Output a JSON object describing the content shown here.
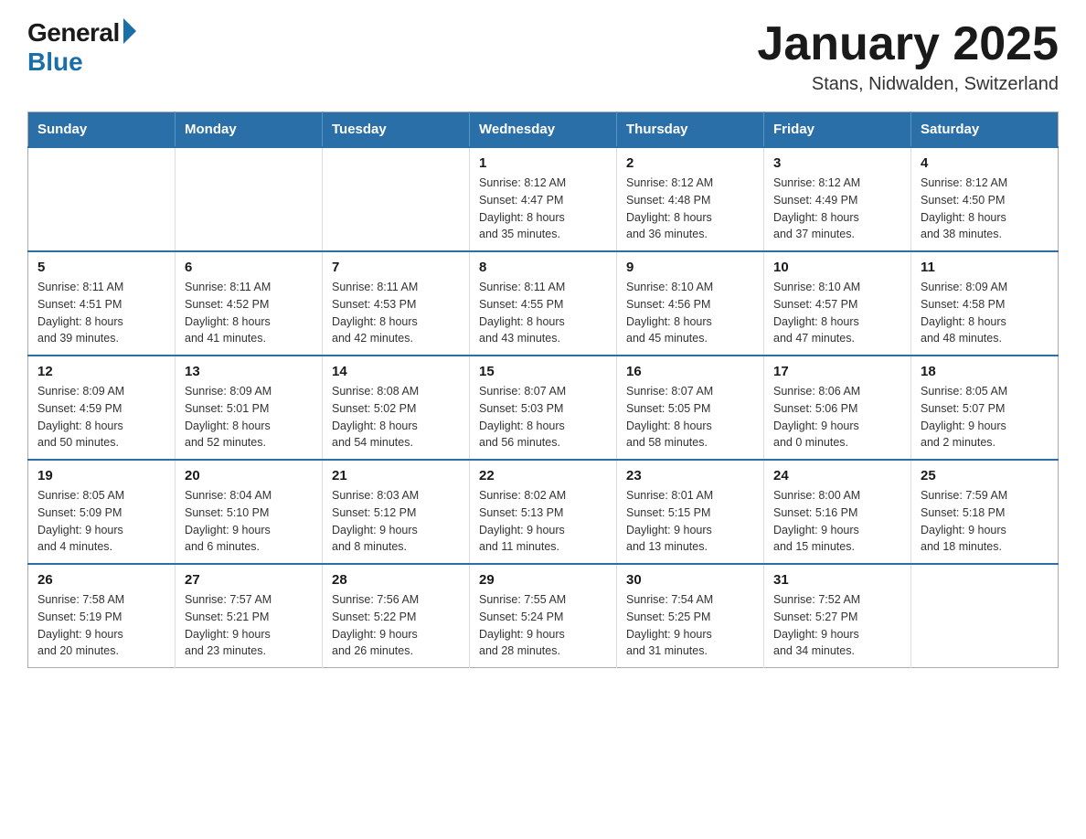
{
  "header": {
    "logo_general": "General",
    "logo_blue": "Blue",
    "month_title": "January 2025",
    "location": "Stans, Nidwalden, Switzerland"
  },
  "days_of_week": [
    "Sunday",
    "Monday",
    "Tuesday",
    "Wednesday",
    "Thursday",
    "Friday",
    "Saturday"
  ],
  "weeks": [
    [
      {
        "day": "",
        "info": ""
      },
      {
        "day": "",
        "info": ""
      },
      {
        "day": "",
        "info": ""
      },
      {
        "day": "1",
        "info": "Sunrise: 8:12 AM\nSunset: 4:47 PM\nDaylight: 8 hours\nand 35 minutes."
      },
      {
        "day": "2",
        "info": "Sunrise: 8:12 AM\nSunset: 4:48 PM\nDaylight: 8 hours\nand 36 minutes."
      },
      {
        "day": "3",
        "info": "Sunrise: 8:12 AM\nSunset: 4:49 PM\nDaylight: 8 hours\nand 37 minutes."
      },
      {
        "day": "4",
        "info": "Sunrise: 8:12 AM\nSunset: 4:50 PM\nDaylight: 8 hours\nand 38 minutes."
      }
    ],
    [
      {
        "day": "5",
        "info": "Sunrise: 8:11 AM\nSunset: 4:51 PM\nDaylight: 8 hours\nand 39 minutes."
      },
      {
        "day": "6",
        "info": "Sunrise: 8:11 AM\nSunset: 4:52 PM\nDaylight: 8 hours\nand 41 minutes."
      },
      {
        "day": "7",
        "info": "Sunrise: 8:11 AM\nSunset: 4:53 PM\nDaylight: 8 hours\nand 42 minutes."
      },
      {
        "day": "8",
        "info": "Sunrise: 8:11 AM\nSunset: 4:55 PM\nDaylight: 8 hours\nand 43 minutes."
      },
      {
        "day": "9",
        "info": "Sunrise: 8:10 AM\nSunset: 4:56 PM\nDaylight: 8 hours\nand 45 minutes."
      },
      {
        "day": "10",
        "info": "Sunrise: 8:10 AM\nSunset: 4:57 PM\nDaylight: 8 hours\nand 47 minutes."
      },
      {
        "day": "11",
        "info": "Sunrise: 8:09 AM\nSunset: 4:58 PM\nDaylight: 8 hours\nand 48 minutes."
      }
    ],
    [
      {
        "day": "12",
        "info": "Sunrise: 8:09 AM\nSunset: 4:59 PM\nDaylight: 8 hours\nand 50 minutes."
      },
      {
        "day": "13",
        "info": "Sunrise: 8:09 AM\nSunset: 5:01 PM\nDaylight: 8 hours\nand 52 minutes."
      },
      {
        "day": "14",
        "info": "Sunrise: 8:08 AM\nSunset: 5:02 PM\nDaylight: 8 hours\nand 54 minutes."
      },
      {
        "day": "15",
        "info": "Sunrise: 8:07 AM\nSunset: 5:03 PM\nDaylight: 8 hours\nand 56 minutes."
      },
      {
        "day": "16",
        "info": "Sunrise: 8:07 AM\nSunset: 5:05 PM\nDaylight: 8 hours\nand 58 minutes."
      },
      {
        "day": "17",
        "info": "Sunrise: 8:06 AM\nSunset: 5:06 PM\nDaylight: 9 hours\nand 0 minutes."
      },
      {
        "day": "18",
        "info": "Sunrise: 8:05 AM\nSunset: 5:07 PM\nDaylight: 9 hours\nand 2 minutes."
      }
    ],
    [
      {
        "day": "19",
        "info": "Sunrise: 8:05 AM\nSunset: 5:09 PM\nDaylight: 9 hours\nand 4 minutes."
      },
      {
        "day": "20",
        "info": "Sunrise: 8:04 AM\nSunset: 5:10 PM\nDaylight: 9 hours\nand 6 minutes."
      },
      {
        "day": "21",
        "info": "Sunrise: 8:03 AM\nSunset: 5:12 PM\nDaylight: 9 hours\nand 8 minutes."
      },
      {
        "day": "22",
        "info": "Sunrise: 8:02 AM\nSunset: 5:13 PM\nDaylight: 9 hours\nand 11 minutes."
      },
      {
        "day": "23",
        "info": "Sunrise: 8:01 AM\nSunset: 5:15 PM\nDaylight: 9 hours\nand 13 minutes."
      },
      {
        "day": "24",
        "info": "Sunrise: 8:00 AM\nSunset: 5:16 PM\nDaylight: 9 hours\nand 15 minutes."
      },
      {
        "day": "25",
        "info": "Sunrise: 7:59 AM\nSunset: 5:18 PM\nDaylight: 9 hours\nand 18 minutes."
      }
    ],
    [
      {
        "day": "26",
        "info": "Sunrise: 7:58 AM\nSunset: 5:19 PM\nDaylight: 9 hours\nand 20 minutes."
      },
      {
        "day": "27",
        "info": "Sunrise: 7:57 AM\nSunset: 5:21 PM\nDaylight: 9 hours\nand 23 minutes."
      },
      {
        "day": "28",
        "info": "Sunrise: 7:56 AM\nSunset: 5:22 PM\nDaylight: 9 hours\nand 26 minutes."
      },
      {
        "day": "29",
        "info": "Sunrise: 7:55 AM\nSunset: 5:24 PM\nDaylight: 9 hours\nand 28 minutes."
      },
      {
        "day": "30",
        "info": "Sunrise: 7:54 AM\nSunset: 5:25 PM\nDaylight: 9 hours\nand 31 minutes."
      },
      {
        "day": "31",
        "info": "Sunrise: 7:52 AM\nSunset: 5:27 PM\nDaylight: 9 hours\nand 34 minutes."
      },
      {
        "day": "",
        "info": ""
      }
    ]
  ]
}
